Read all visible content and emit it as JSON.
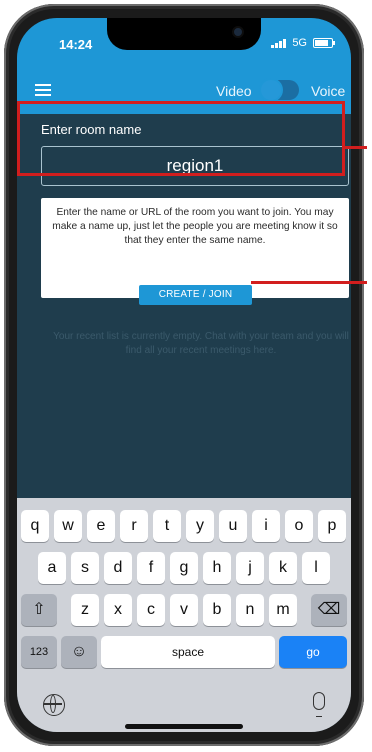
{
  "status_bar": {
    "time": "14:24",
    "network": "5G"
  },
  "toolbar": {
    "video_label": "Video",
    "voice_label": "Voice"
  },
  "room": {
    "label": "Enter room name",
    "value": "region1"
  },
  "info_card": {
    "text": "Enter the name or URL of the room you want to join. You may make a name up, just let the people you are meeting know it so that they enter the same name.",
    "button_label": "CREATE / JOIN"
  },
  "recent": {
    "empty_text": "Your recent list is currently empty. Chat with your team and you will find all your recent meetings here."
  },
  "keyboard": {
    "row1": [
      "q",
      "w",
      "e",
      "r",
      "t",
      "y",
      "u",
      "i",
      "o",
      "p"
    ],
    "row2": [
      "a",
      "s",
      "d",
      "f",
      "g",
      "h",
      "j",
      "k",
      "l"
    ],
    "row3": [
      "z",
      "x",
      "c",
      "v",
      "b",
      "n",
      "m"
    ],
    "shift_icon": "⇧",
    "backspace_icon": "⌫",
    "numbers_label": "123",
    "emoji_icon": "☺",
    "space_label": "space",
    "go_label": "go"
  },
  "colors": {
    "accent": "#1e97d6",
    "background": "#1f3d4d",
    "highlight": "#d21e1e"
  },
  "icons": [
    "menu-icon",
    "signal-icon",
    "battery-icon",
    "globe-icon",
    "microphone-icon",
    "shift-icon",
    "backspace-icon",
    "emoji-icon"
  ]
}
